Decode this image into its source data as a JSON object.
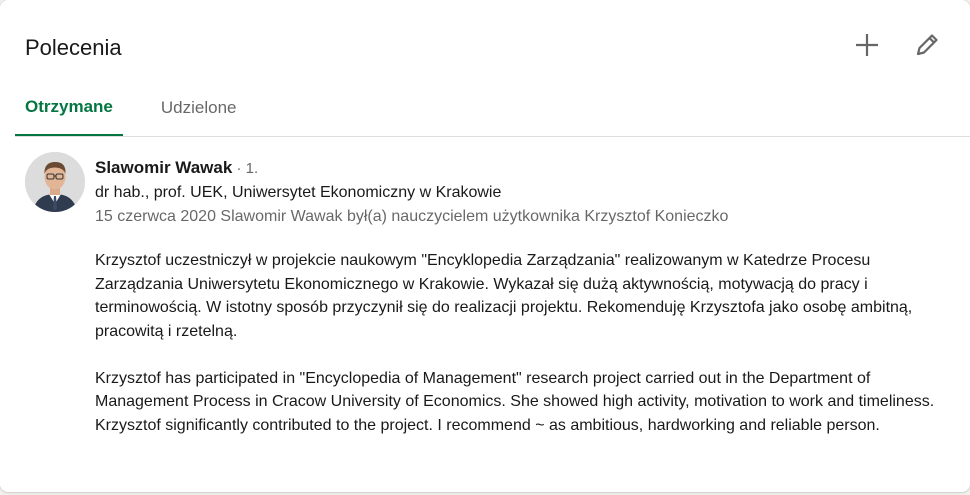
{
  "section": {
    "title": "Polecenia",
    "add_icon": "plus-icon",
    "edit_icon": "pencil-icon"
  },
  "tabs": [
    {
      "label": "Otrzymane",
      "active": true
    },
    {
      "label": "Udzielone",
      "active": false
    }
  ],
  "accent_color": "#057642",
  "recommendation": {
    "name": "Slawomir Wawak",
    "degree": " · 1.",
    "headline": "dr hab., prof. UEK, Uniwersytet Ekonomiczny w Krakowie",
    "meta": "15 czerwca 2020 Slawomir Wawak był(a) nauczycielem użytkownika Krzysztof Konieczko",
    "paragraphs": [
      "Krzysztof uczestniczył w projekcie naukowym \"Encyklopedia Zarządzania\" realizowanym w Katedrze Procesu Zarządzania Uniwersytetu Ekonomicznego w Krakowie. Wykazał się dużą aktywnością, motywacją do pracy i terminowością. W istotny sposób przyczynił się do realizacji projektu. Rekomenduję Krzysztofa jako osobę ambitną, pracowitą i rzetelną.",
      "Krzysztof has participated in \"Encyclopedia of Management\" research project carried out in the Department of Management Process in Cracow University of Economics. She showed high activity, motivation to work and timeliness. Krzysztof significantly contributed to the project. I recommend ~ as ambitious, hardworking and reliable person."
    ]
  }
}
